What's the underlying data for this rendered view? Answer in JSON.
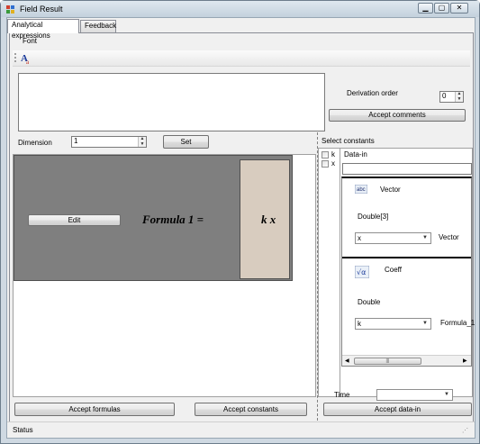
{
  "window": {
    "title": "Field Result"
  },
  "tabs": [
    {
      "label": "Analytical expressions"
    },
    {
      "label": "Feedback"
    }
  ],
  "menu": {
    "font_label": "Font"
  },
  "toolbar": {
    "font_icon": "font-style-icon"
  },
  "comments": {
    "text": ""
  },
  "derivation": {
    "label": "Derivation order",
    "value": "0"
  },
  "accept_comments_label": "Accept comments",
  "dimension": {
    "label": "Dimension",
    "value": "1",
    "set_label": "Set"
  },
  "formula": {
    "edit_label": "Edit",
    "name": "Formula 1 =",
    "expression": "k x"
  },
  "constants": {
    "header": "Select constants",
    "items": [
      {
        "label": "k"
      },
      {
        "label": "x"
      }
    ],
    "data_header": "Data-in",
    "data_input": ""
  },
  "vector_card": {
    "icon": "vector-icon",
    "title": "Vector",
    "type": "Double[3]",
    "selected": "x",
    "side_label": "Vector"
  },
  "coeff_card": {
    "icon": "sqrt-alpha-icon",
    "title": "Coeff",
    "type": "Double",
    "selected": "k",
    "side_label": "Formula_1"
  },
  "time": {
    "label": "Time",
    "value": ""
  },
  "buttons": {
    "accept_formulas": "Accept formulas",
    "accept_constants": "Accept constants",
    "accept_data_in": "Accept data-in"
  },
  "status": {
    "text": "Status"
  },
  "colors": {
    "formula_bg": "#7f7f7f",
    "expression_bg": "#d8ccbf"
  }
}
